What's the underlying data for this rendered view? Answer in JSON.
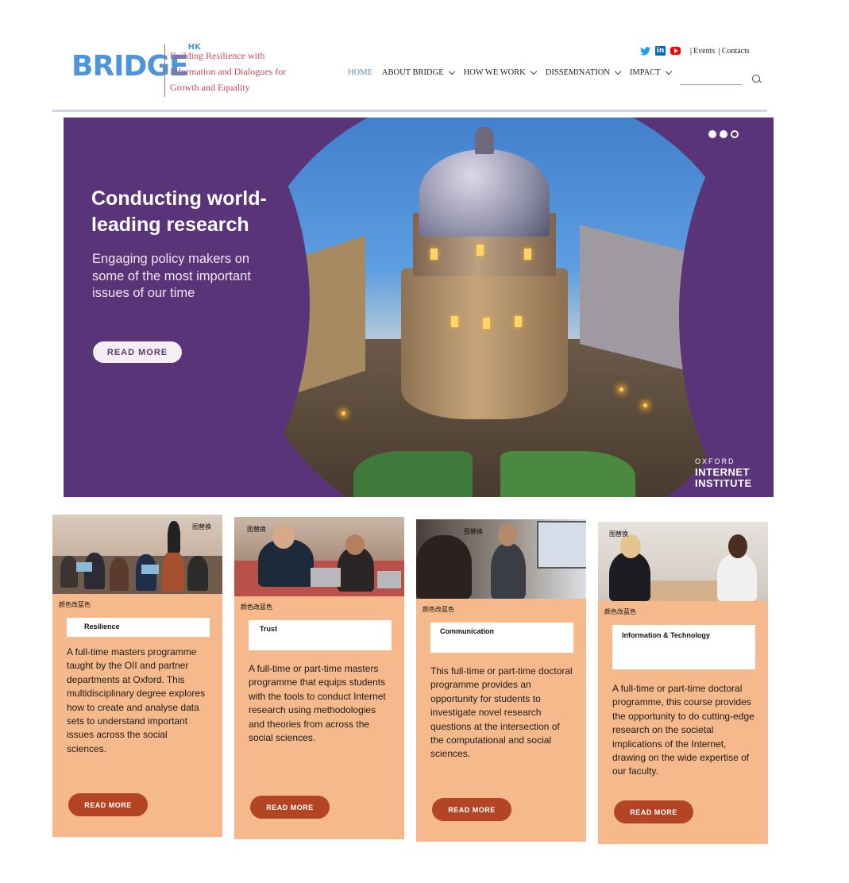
{
  "header": {
    "logo_text": "BRIDGE",
    "logo_sup": "HK",
    "tagline": "Building Resilience with Information and Dialogues for Growth and Equality",
    "top_links": [
      "Events",
      "Contacts"
    ],
    "social_icons": [
      "twitter-icon",
      "linkedin-icon",
      "youtube-icon"
    ],
    "linkedin_glyph": "in",
    "nav": [
      "HOME",
      "ABOUT BRIDGE",
      "HOW WE WORK",
      "DISSEMINATION",
      "IMPACT"
    ],
    "active_nav": "HOME",
    "search_placeholder": ""
  },
  "hero": {
    "title": "Conducting world-leading research",
    "subtitle": "Engaging policy makers on some of the most important issues of our time",
    "button": "READ MORE",
    "logo_lines": [
      "OXFORD",
      "INTERNET",
      "INSTITUTE"
    ],
    "slider_dots": 3,
    "active_dot": 2
  },
  "cards": [
    {
      "photo_note": "图替换",
      "note": "颜色改蓝色",
      "title": "Resilience",
      "description": "A full-time masters programme taught by the OII and partner departments at Oxford. This multidisciplinary degree explores how to create and analyse data sets to understand important issues across the social sciences.",
      "button": "READ MORE"
    },
    {
      "photo_note": "图替换",
      "note": "颜色改蓝色",
      "title": "Trust",
      "description": "A full-time or part-time masters programme that equips students with the tools to conduct Internet research using methodologies and theories from across the social sciences.",
      "button": "READ MORE"
    },
    {
      "photo_note": "图替换",
      "note": "颜色改蓝色",
      "title": "Communication",
      "description": "This full-time or part-time doctoral programme provides an opportunity for students to investigate novel research questions at the intersection of the computational and social sciences.",
      "button": "READ MORE"
    },
    {
      "photo_note": "图替换",
      "note": "颜色改蓝色",
      "title": "Information & Technology",
      "description": "A full-time or part-time doctoral programme, this course provides the opportunity to do cutting-edge research on the societal implications of the Internet, drawing on the wide expertise of our faculty.",
      "button": "READ MORE"
    }
  ],
  "colors": {
    "brand_blue": "#4b95d8",
    "tagline_red": "#c94a55",
    "hero_purple": "#5a3478",
    "card_peach": "#f6b98c",
    "card_button": "#b34424"
  }
}
